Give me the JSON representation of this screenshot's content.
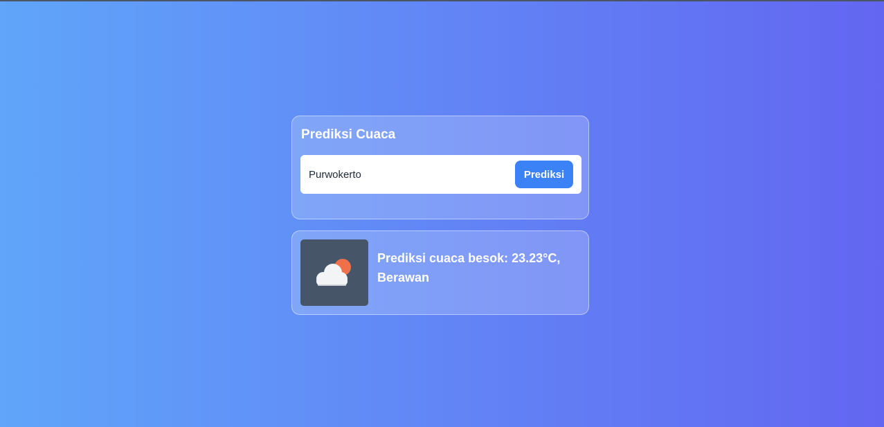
{
  "app": {
    "title": "Prediksi Cuaca"
  },
  "search": {
    "value": "Purwokerto",
    "button_label": "Prediksi"
  },
  "result": {
    "text": "Prediksi cuaca besok: 23.23°C, Berawan",
    "icon": "partly-cloudy-icon"
  },
  "colors": {
    "gradient_start": "#60a5fa",
    "gradient_end": "#6366f1",
    "button": "#3b82f6",
    "icon_tile": "#475569",
    "sun": "#f0704a"
  }
}
